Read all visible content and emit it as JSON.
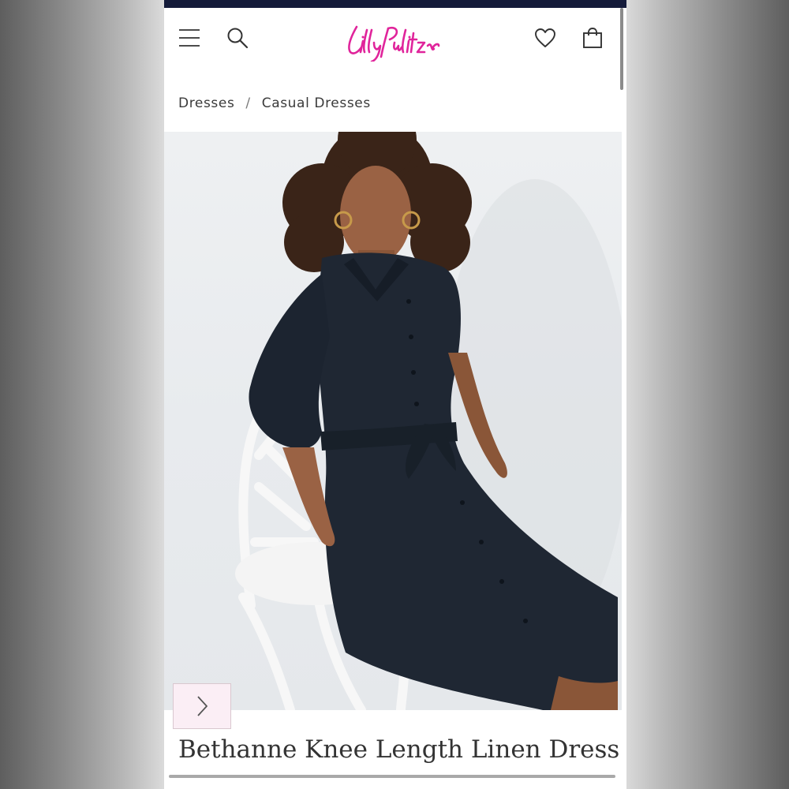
{
  "brand": {
    "logo_text": "Lilly Pulitzer",
    "accent_color": "#e0249b",
    "nav_strip_color": "#141b3a"
  },
  "header": {
    "menu_icon": "hamburger-menu-icon",
    "search_icon": "search-icon",
    "wishlist_icon": "heart-icon",
    "bag_icon": "shopping-bag-icon"
  },
  "breadcrumb": {
    "items": [
      "Dresses",
      "Casual Dresses"
    ],
    "separator": "/"
  },
  "gallery": {
    "next_icon": "chevron-right-icon"
  },
  "product": {
    "title": "Bethanne Knee Length Linen Dress"
  }
}
